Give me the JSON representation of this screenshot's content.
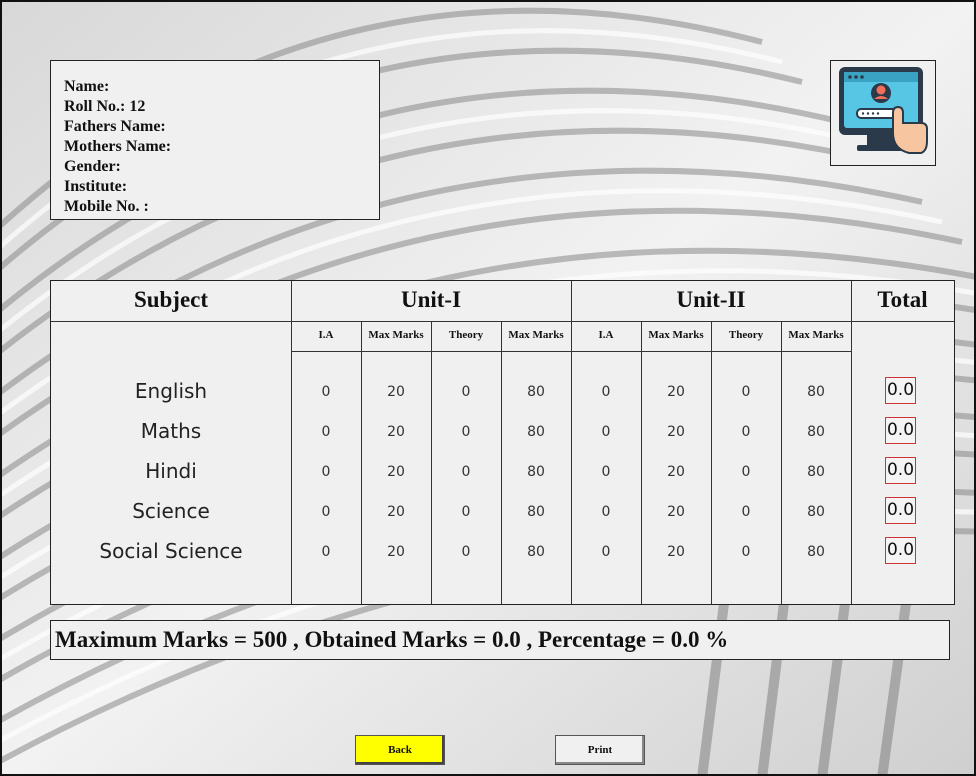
{
  "student": {
    "name": "Name:",
    "roll": "Roll No.: 12",
    "father": "Fathers Name:",
    "mother": "Mothers Name:",
    "gender": "Gender:",
    "institute": "Institute:",
    "mobile": "Mobile No. :"
  },
  "table": {
    "headers": {
      "subject": "Subject",
      "unit1": "Unit-I",
      "unit2": "Unit-II",
      "total": "Total"
    },
    "subheaders": [
      "I.A",
      "Max Marks",
      "Theory",
      "Max Marks",
      "I.A",
      "Max Marks",
      "Theory",
      "Max Marks"
    ],
    "rows": [
      {
        "subject": "English",
        "u1_ia": "0",
        "u1_max1": "20",
        "u1_theory": "0",
        "u1_max2": "80",
        "u2_ia": "0",
        "u2_max1": "20",
        "u2_theory": "0",
        "u2_max2": "80",
        "total": "0.0"
      },
      {
        "subject": "Maths",
        "u1_ia": "0",
        "u1_max1": "20",
        "u1_theory": "0",
        "u1_max2": "80",
        "u2_ia": "0",
        "u2_max1": "20",
        "u2_theory": "0",
        "u2_max2": "80",
        "total": "0.0"
      },
      {
        "subject": "Hindi",
        "u1_ia": "0",
        "u1_max1": "20",
        "u1_theory": "0",
        "u1_max2": "80",
        "u2_ia": "0",
        "u2_max1": "20",
        "u2_theory": "0",
        "u2_max2": "80",
        "total": "0.0"
      },
      {
        "subject": "Science",
        "u1_ia": "0",
        "u1_max1": "20",
        "u1_theory": "0",
        "u1_max2": "80",
        "u2_ia": "0",
        "u2_max1": "20",
        "u2_theory": "0",
        "u2_max2": "80",
        "total": "0.0"
      },
      {
        "subject": "Social Science",
        "u1_ia": "0",
        "u1_max1": "20",
        "u1_theory": "0",
        "u1_max2": "80",
        "u2_ia": "0",
        "u2_max1": "20",
        "u2_theory": "0",
        "u2_max2": "80",
        "total": "0.0"
      }
    ]
  },
  "summary": "Maximum Marks = 500  ,  Obtained Marks = 0.0 , Percentage = 0.0 %",
  "buttons": {
    "back": "Back",
    "print": "Print"
  },
  "logo_icon": "computer-login-hand-icon",
  "colors": {
    "back_button": "#ffff00",
    "total_border": "#cc3333"
  }
}
